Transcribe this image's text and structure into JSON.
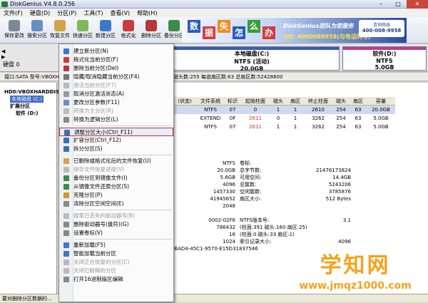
{
  "window": {
    "title": "DiskGenius V4.8.0.256"
  },
  "menubar": [
    "文件(F)",
    "硬盘(D)",
    "分区(P)",
    "工具(T)",
    "查看(V)",
    "帮助(H)"
  ],
  "toolbar": [
    {
      "label": "保存更改",
      "icon": "save-icon",
      "color": "#7d8796"
    },
    {
      "label": "搜索分区",
      "icon": "search-icon",
      "color": "#6e8cc4"
    },
    {
      "label": "恢复文件",
      "icon": "recover-icon",
      "color": "#d2a449"
    },
    {
      "label": "快速分区",
      "icon": "quick-partition-icon",
      "color": "#7fb85a"
    },
    {
      "label": "新建分区",
      "icon": "new-partition-icon",
      "color": "#3f78c6"
    },
    {
      "label": "格式化",
      "icon": "format-icon",
      "color": "#c73d3d"
    },
    {
      "label": "删除分区",
      "icon": "delete-icon",
      "color": "#b23a3a"
    },
    {
      "label": "备份分区",
      "icon": "backup-icon",
      "color": "#3b8b4b"
    }
  ],
  "banner": {
    "chars": [
      "数",
      "据",
      "失",
      "怎",
      "么",
      "办"
    ],
    "brand": "DiskGenius团队为您服务",
    "qq": "QQ: 4000089958(与电话同号)",
    "phone": "400-008-9958"
  },
  "diskbar": {
    "disk_label": "硬盘 0",
    "part_c": {
      "name": "本地磁盘(C:)",
      "fs": "NTFS (活动)",
      "size": "20.0GB"
    },
    "part_d": {
      "name": "软件(D:)",
      "fs": "NTFS",
      "size": "5.0GB"
    }
  },
  "infoline": "接口:SATA  型号:VBOXHARDDISK  容量:25.0GB(25600MB)  柱面数:3263  磁头数:255  每道扇区数:63  总扇区数:52428800",
  "tree": [
    "HD0:VBOXHARDDISK",
    "本地磁盘 (C:)",
    "扩展分区",
    "软件 (D:)"
  ],
  "table": {
    "headers": [
      "(状态)",
      "文件系统",
      "标识",
      "起始柱面",
      "磁头",
      "扇区",
      "终止柱面",
      "磁头",
      "扇区",
      "容量"
    ],
    "rows": [
      [
        "",
        "NTFS",
        "07",
        "0",
        "1",
        "1",
        "2610",
        "254",
        "63",
        "20.0GB"
      ],
      [
        "",
        "EXTEND",
        "0F",
        "2611",
        "0",
        "1",
        "3262",
        "254",
        "63",
        "5.0GB"
      ],
      [
        "",
        "NTFS",
        "07",
        "2611",
        "1",
        "1",
        "3262",
        "254",
        "63",
        "5.0GB"
      ]
    ]
  },
  "details": [
    [
      "",
      "NTFS",
      "卷标:",
      ""
    ],
    [
      "",
      "20.0GB",
      "总字节数:",
      "21476173824"
    ],
    [
      "",
      "5.6GB",
      "可用空间:",
      "14.4GB"
    ],
    [
      "",
      "4096",
      "总簇数:",
      "5243206"
    ],
    [
      "",
      "1457330",
      "空闲簇数:",
      "3785876"
    ],
    [
      "",
      "41945652",
      "扇区大小:",
      "512 Bytes"
    ],
    [
      "",
      "2048",
      "",
      ""
    ],
    [
      "",
      "",
      "",
      ""
    ],
    [
      "",
      "0002-02F6",
      "NTFS版本号:",
      "3.1"
    ],
    [
      "",
      "786432",
      "(柱面:391 磁头:160 扇区:25)",
      ""
    ],
    [
      "",
      "16",
      "(柱面:0 磁头:33 扇区:1)",
      ""
    ],
    [
      "",
      "1024",
      "索引记录大小:",
      "4096"
    ],
    [
      "",
      "-BAD4-45C1-9570-E15D31837546",
      "",
      ""
    ]
  ],
  "context_menu": [
    {
      "label": "建立新分区(N)",
      "enabled": true,
      "icon": "new-partition-icon",
      "color": "#3f78c6"
    },
    {
      "label": "格式化当前分区(F)",
      "enabled": true,
      "icon": "format-icon",
      "color": "#c73d3d"
    },
    {
      "label": "删除当前分区(Del)",
      "enabled": true,
      "icon": "delete-icon",
      "color": "#b23a3a"
    },
    {
      "label": "隐藏/取消隐藏当前分区(F4)",
      "enabled": true,
      "icon": "hide-icon",
      "color": "#777"
    },
    {
      "label": "激活当前分区(F7)",
      "enabled": false,
      "icon": "activate-icon",
      "color": "#bbb"
    },
    {
      "label": "取消分区激活状态(A)",
      "enabled": true,
      "icon": "deactivate-icon",
      "color": "#999"
    },
    {
      "label": "更改分区参数(F11)",
      "enabled": true,
      "icon": "params-icon",
      "color": "#6c8fc4"
    },
    {
      "label": "转换为主分区(R)",
      "enabled": false,
      "icon": "convert-icon",
      "color": "#bbb"
    },
    {
      "label": "转换为逻辑分区(L)",
      "enabled": true,
      "icon": "convert-logical-icon",
      "color": "#888"
    },
    {
      "sep": true
    },
    {
      "label": "调整分区大小(Ctrl_F11)",
      "enabled": true,
      "icon": "resize-icon",
      "color": "#3c6fb0",
      "highlight": true
    },
    {
      "label": "扩容分区(Ctrl_F12)",
      "enabled": true,
      "icon": "extend-icon",
      "color": "#3c6fb0"
    },
    {
      "label": "拆分分区(S)",
      "enabled": true,
      "icon": "split-icon",
      "color": "#3c6fb0"
    },
    {
      "sep": true
    },
    {
      "label": "已删除或格式化后的文件恢复(U)",
      "enabled": true,
      "icon": "undelete-icon",
      "color": "#d2a449"
    },
    {
      "label": "保存文件恢复进度(V)",
      "enabled": false,
      "icon": "save-progress-icon",
      "color": "#bbb"
    },
    {
      "label": "备份分区到镜像文件(I)",
      "enabled": true,
      "icon": "backup-icon",
      "color": "#3b8b4b"
    },
    {
      "label": "从镜像文件还原分区(S)",
      "enabled": true,
      "icon": "restore-icon",
      "color": "#3b8b4b"
    },
    {
      "label": "克隆分区(P)",
      "enabled": true,
      "icon": "clone-icon",
      "color": "#c89a32"
    },
    {
      "label": "清除分区空闲空间(E)",
      "enabled": true,
      "icon": "wipe-icon",
      "color": "#888"
    },
    {
      "sep": true
    },
    {
      "label": "搜索已丢失的驱动器号(B)",
      "enabled": false,
      "icon": "letter-icon",
      "color": "#bbb"
    },
    {
      "label": "删除驱动器号(盘符)(G)",
      "enabled": true,
      "icon": "remove-letter-icon",
      "color": "#888"
    },
    {
      "label": "设置卷标(V)",
      "enabled": true,
      "icon": "label-icon",
      "color": "#888"
    },
    {
      "sep": true
    },
    {
      "label": "重新加载(F5)",
      "enabled": true,
      "icon": "reload-icon",
      "color": "#3f78c6"
    },
    {
      "label": "智能加载当前分区",
      "enabled": true,
      "icon": "smart-load-icon",
      "color": "#3f78c6"
    },
    {
      "label": "关闭正在恢复的分区(C)",
      "enabled": false,
      "icon": "close-partition-icon",
      "color": "#bbb"
    },
    {
      "label": "关闭已解释的分区",
      "enabled": false,
      "icon": "close-explained-icon",
      "color": "#bbb"
    },
    {
      "label": "打开16进制扇区编辑",
      "enabled": true,
      "icon": "hex-icon",
      "color": "#888"
    }
  ],
  "statusbar": "要对删除分区数据的...",
  "watermark": {
    "big": "学知网",
    "url": "www.jmqz1000.com"
  }
}
